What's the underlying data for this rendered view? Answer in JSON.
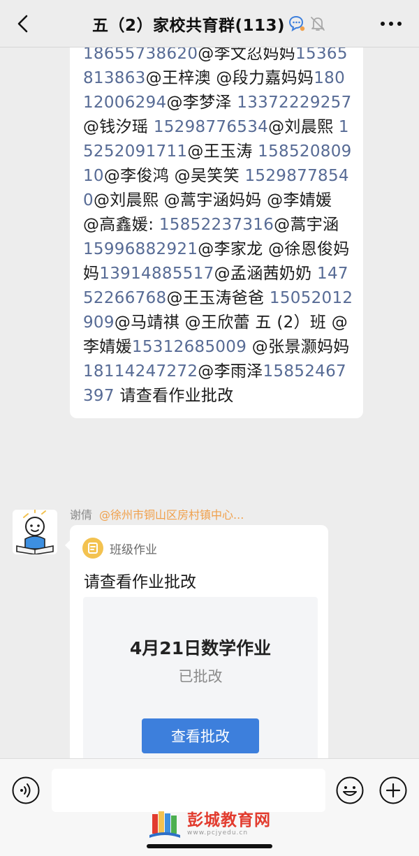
{
  "header": {
    "title": "五（2）家校共育群(113)"
  },
  "message1": {
    "segments": [
      {
        "t": "18655738620",
        "phone": true
      },
      {
        "t": "@李文忍妈妈",
        "phone": false
      },
      {
        "t": "15365813863",
        "phone": true
      },
      {
        "t": "@王梓澳 @段力嘉妈妈",
        "phone": false
      },
      {
        "t": "18012006294",
        "phone": true
      },
      {
        "t": "@李梦泽 ",
        "phone": false
      },
      {
        "t": "13372229257",
        "phone": true
      },
      {
        "t": "@钱汐瑶 ",
        "phone": false
      },
      {
        "t": "15298776534",
        "phone": true
      },
      {
        "t": "@刘晨熙 ",
        "phone": false
      },
      {
        "t": "15252091711",
        "phone": true
      },
      {
        "t": "@王玉涛 ",
        "phone": false
      },
      {
        "t": "15852080910",
        "phone": true
      },
      {
        "t": "@李俊鸿 @吴笑笑 ",
        "phone": false
      },
      {
        "t": "15298778540",
        "phone": true
      },
      {
        "t": "@刘晨熙 @蒿宇涵妈妈 @李婧媛 @高鑫媛: ",
        "phone": false
      },
      {
        "t": "15852237316",
        "phone": true
      },
      {
        "t": "@蒿宇涵 ",
        "phone": false
      },
      {
        "t": "15996882921",
        "phone": true
      },
      {
        "t": "@李家龙 @徐恩俊妈妈",
        "phone": false
      },
      {
        "t": "13914885517",
        "phone": true
      },
      {
        "t": "@孟涵茜奶奶 ",
        "phone": false
      },
      {
        "t": "14752266768",
        "phone": true
      },
      {
        "t": "@王玉涛爸爸 ",
        "phone": false
      },
      {
        "t": "15052012909",
        "phone": true
      },
      {
        "t": "@马靖祺 @王欣蕾 五 (2）班 @李婧媛",
        "phone": false
      },
      {
        "t": "15312685009",
        "phone": true
      },
      {
        "t": " @张景灏妈妈",
        "phone": false
      },
      {
        "t": "18114247272",
        "phone": true
      },
      {
        "t": "@李雨泽",
        "phone": false
      },
      {
        "t": "15852467397",
        "phone": true
      },
      {
        "t": " 请查看作业批改",
        "phone": false
      }
    ]
  },
  "message2": {
    "sender": "谢倩",
    "sender_tag": "@徐州市铜山区房村镇中心...",
    "card": {
      "app_label": "班级作业",
      "message": "请查看作业批改",
      "homework_title": "4月21日数学作业",
      "status": "已批改",
      "button_label": "查看批改"
    }
  },
  "input": {
    "placeholder": ""
  },
  "watermark": {
    "name": "彭城教育网",
    "url": "www.pcjyedu.cn"
  },
  "colors": {
    "phone_link": "#576b95",
    "button_blue": "#3d7fdc",
    "tag_orange": "#f0a04b"
  }
}
